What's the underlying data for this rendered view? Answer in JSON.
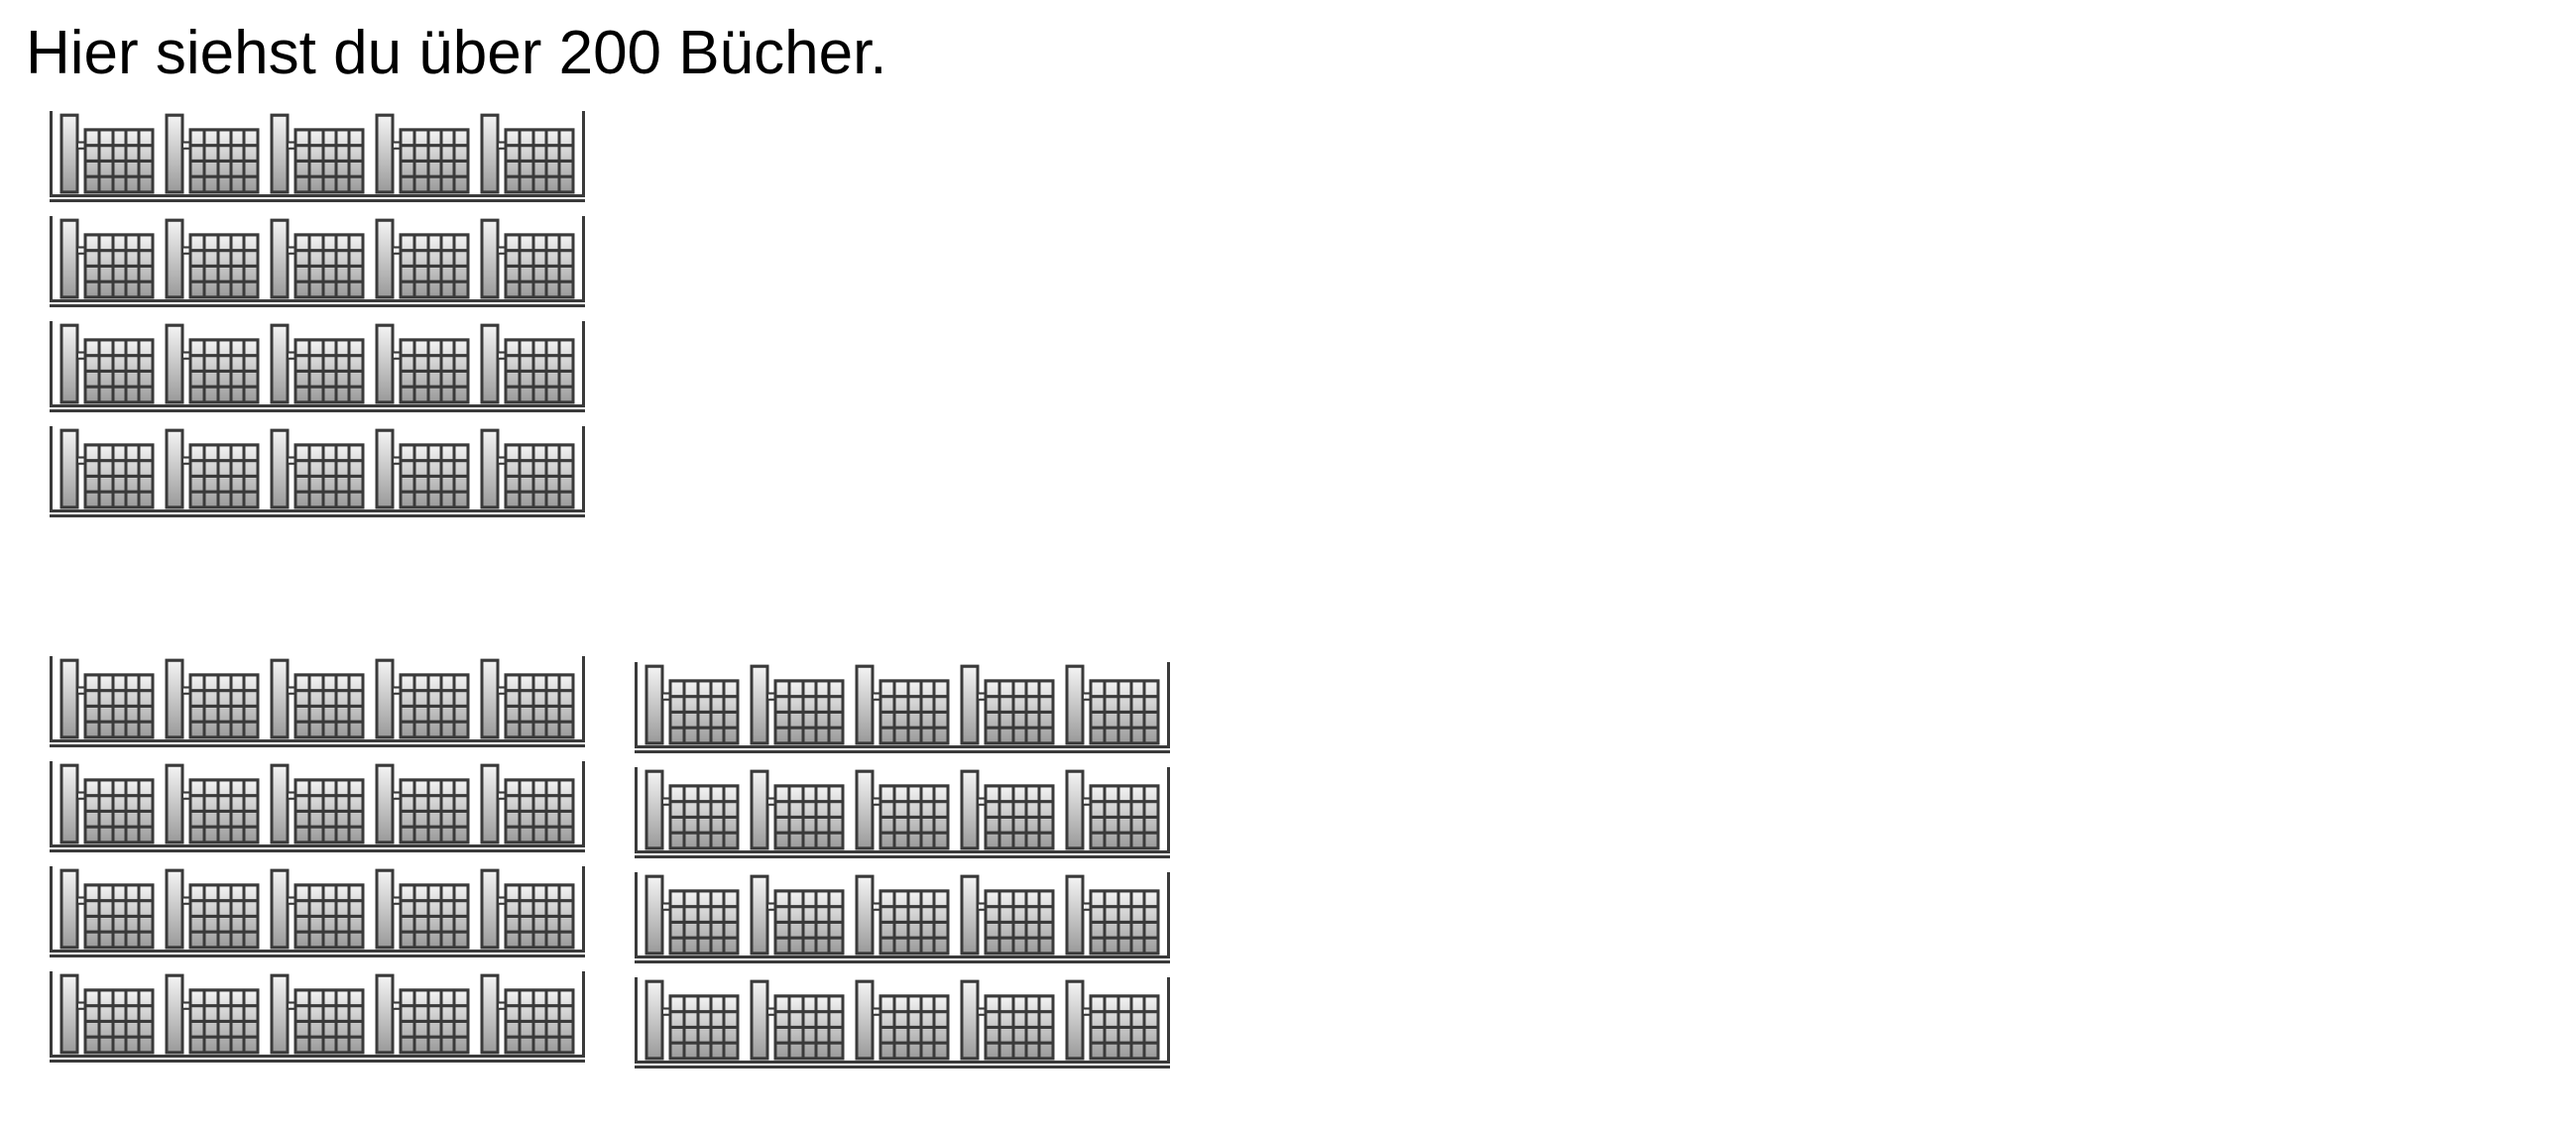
{
  "caption": "Hier siehst du über 200 Bücher.",
  "shelf_groups": [
    {
      "shelves": 4,
      "bundles_per_shelf": 5
    },
    {
      "shelves": 4,
      "bundles_per_shelf": 5
    },
    {
      "shelves": 4,
      "bundles_per_shelf": 5
    }
  ],
  "colors": {
    "text": "#000000",
    "outline": "#3a3a3a",
    "book_light": "#f4f4f4",
    "book_dark": "#9a9a9a"
  },
  "icon_names": {
    "book_bundle": "book-bundle-icon",
    "shelf": "bookshelf-icon"
  }
}
